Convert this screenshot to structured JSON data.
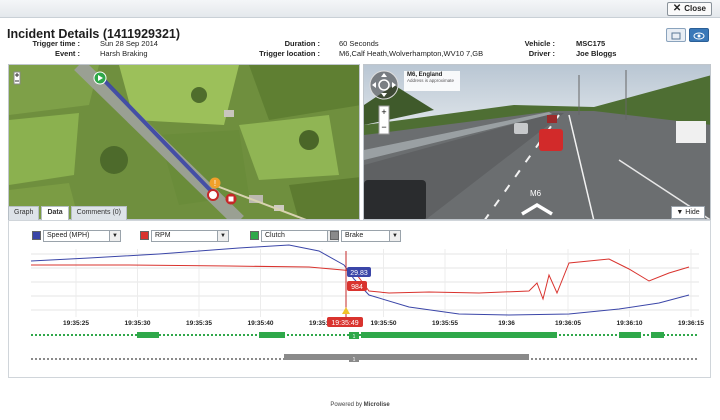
{
  "window": {
    "close_label": "Close"
  },
  "incident": {
    "title": "Incident Details (1411929321)",
    "trigger_time_label": "Trigger time :",
    "trigger_time": "Sun 28 Sep 2014",
    "event_label": "Event :",
    "event": "Harsh Braking",
    "duration_label": "Duration :",
    "duration": "60 Seconds",
    "trigger_location_label": "Trigger location :",
    "trigger_location": "M6,Calf Heath,Wolverhampton,WV10 7,GB",
    "vehicle_label": "Vehicle :",
    "vehicle": "MSC175",
    "driver_label": "Driver :",
    "driver": "Joe Bloggs"
  },
  "tabs": [
    "Graph",
    "Data",
    "Comments (0)"
  ],
  "streetview": {
    "place": "M6, England",
    "note": "Address is approximate",
    "road_label": "M6",
    "hide_label": "Hide"
  },
  "legend": [
    {
      "label": "Speed (MPH)",
      "color": "#3b46a8"
    },
    {
      "label": "RPM",
      "color": "#d9332e"
    },
    {
      "label": "Clutch",
      "color": "#2fa84a"
    },
    {
      "label": "Brake",
      "color": "#8a8a8a"
    }
  ],
  "graph": {
    "speed_value": "29.83",
    "rpm_value": "984",
    "cursor_time": "19:35:49",
    "times": [
      "19:35:25",
      "19:35:30",
      "19:35:35",
      "19:35:40",
      "19:35:45",
      "19:35:50",
      "19:35:55",
      "19:36",
      "19:36:05",
      "19:36:10",
      "19:36:15",
      "19:3"
    ],
    "marker_label": "1"
  },
  "footer": {
    "prefix": "Powered by",
    "brand": "Microlise"
  }
}
